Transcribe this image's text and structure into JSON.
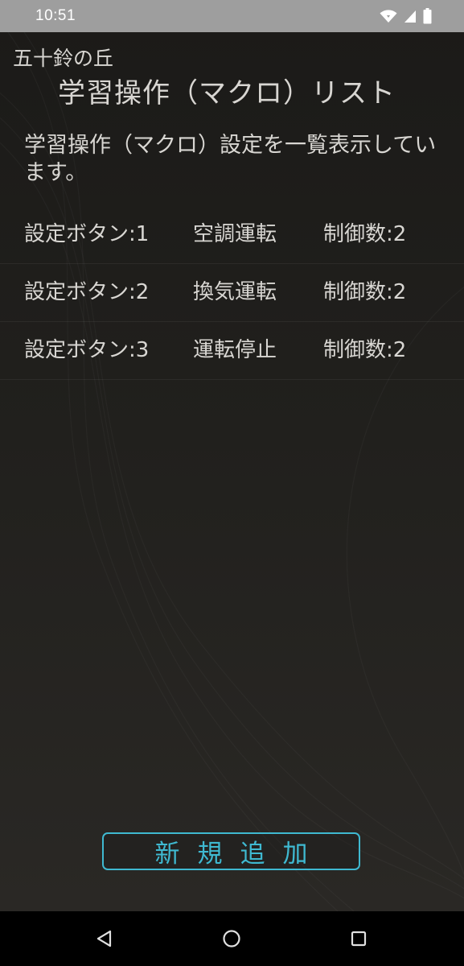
{
  "status_bar": {
    "time": "10:51",
    "icons": [
      "wifi-icon",
      "cell-signal-icon",
      "battery-icon"
    ]
  },
  "header": {
    "app_name": "五十鈴の丘",
    "title": "学習操作（マクロ）リスト"
  },
  "description": "学習操作（マクロ）設定を一覧表示しています。",
  "macros": [
    {
      "button": "設定ボタン:1",
      "name": "空調運転",
      "count": "制御数:2"
    },
    {
      "button": "設定ボタン:2",
      "name": "換気運転",
      "count": "制御数:2"
    },
    {
      "button": "設定ボタン:3",
      "name": "運転停止",
      "count": "制御数:2"
    }
  ],
  "add_button": {
    "label": "新規追加"
  },
  "nav_bar": {
    "icons": [
      "back-icon",
      "home-icon",
      "recent-apps-icon"
    ]
  },
  "colors": {
    "accent": "#3fb9d1",
    "status_bar": "#9e9e9e",
    "text": "#d8d6d2",
    "background": "#1c1b19"
  }
}
